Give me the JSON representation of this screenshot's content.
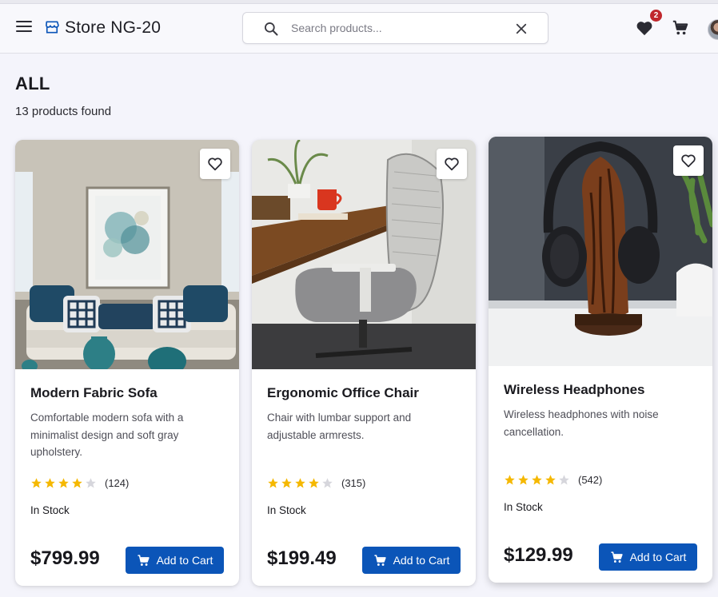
{
  "header": {
    "store_name": "Store NG-20",
    "search_placeholder": "Search products...",
    "wishlist_count": "2"
  },
  "page": {
    "category": "ALL",
    "results_text": "13 products found"
  },
  "products": [
    {
      "name": "Modern Fabric Sofa",
      "description": "Comfortable modern sofa with a minimalist design and soft gray upholstery.",
      "rating": 4,
      "reviews": "(124)",
      "stock": "In Stock",
      "price": "$799.99",
      "cta": "Add to Cart"
    },
    {
      "name": "Ergonomic Office Chair",
      "description": "Chair with lumbar support and adjustable armrests.",
      "rating": 4,
      "reviews": "(315)",
      "stock": "In Stock",
      "price": "$199.49",
      "cta": "Add to Cart"
    },
    {
      "name": "Wireless Headphones",
      "description": "Wireless headphones with noise cancellation.",
      "rating": 4,
      "reviews": "(542)",
      "stock": "In Stock",
      "price": "$129.99",
      "cta": "Add to Cart"
    }
  ],
  "colors": {
    "primary": "#0b55b8",
    "badge": "#c0272d",
    "star": "#f5b800",
    "star_empty": "#d6d6dc"
  },
  "icons": [
    "menu-icon",
    "store-icon",
    "search-icon",
    "close-icon",
    "heart-icon",
    "cart-icon",
    "avatar",
    "heart-outline-icon",
    "star-icon",
    "cart-icon"
  ]
}
